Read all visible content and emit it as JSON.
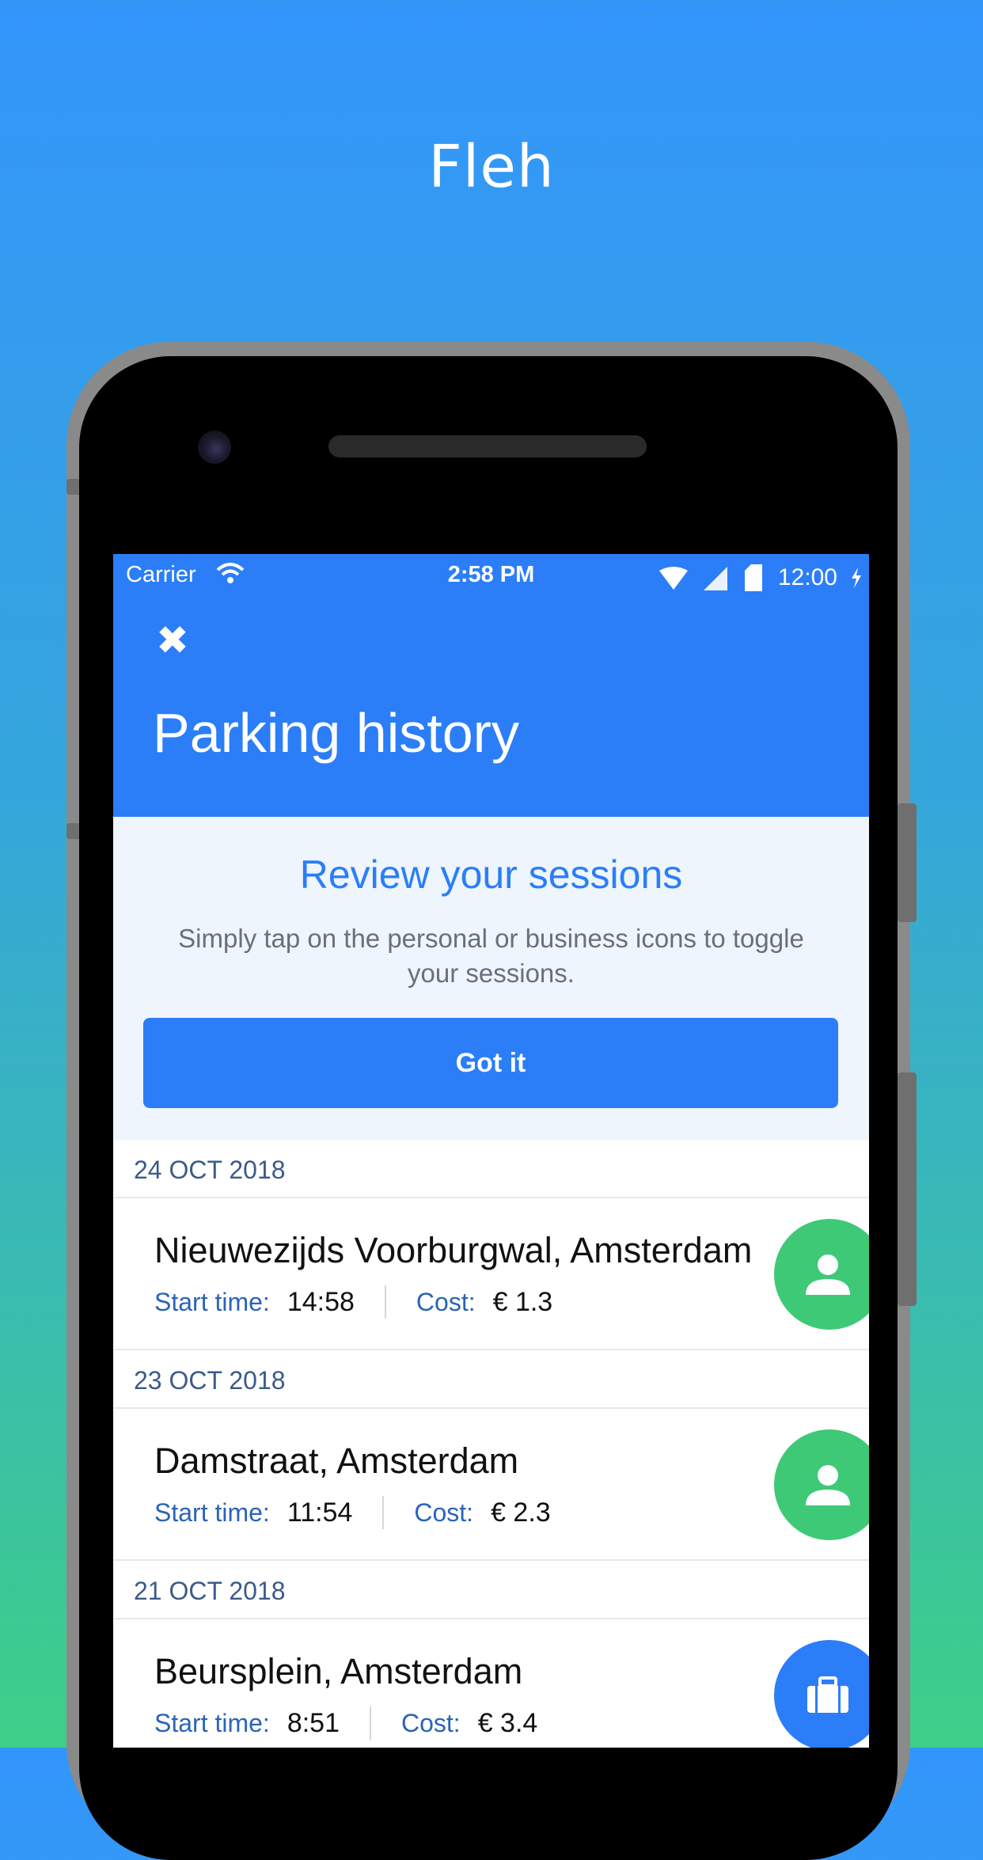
{
  "brand_title": "Fleh",
  "status_bar": {
    "carrier": "Carrier",
    "time": "2:58 PM",
    "clock": "12:00"
  },
  "header": {
    "title": "Parking history"
  },
  "banner": {
    "title": "Review your sessions",
    "text": "Simply tap on the personal or business icons to toggle your sessions.",
    "button_label": "Got it"
  },
  "labels": {
    "start_time": "Start time:",
    "cost": "Cost:"
  },
  "sessions": [
    {
      "date": "24 OCT 2018",
      "location": "Nieuwezijds Voorburgwal, Amsterdam",
      "start_time": "14:58",
      "cost": "€ 1.3",
      "type": "personal",
      "icon": "person-icon"
    },
    {
      "date": "23 OCT 2018",
      "location": "Damstraat, Amsterdam",
      "start_time": "11:54",
      "cost": "€ 2.3",
      "type": "personal",
      "icon": "person-icon"
    },
    {
      "date": "21 OCT 2018",
      "location": "Beursplein, Amsterdam",
      "start_time": "8:51",
      "cost": "€ 3.4",
      "type": "business",
      "icon": "briefcase-icon"
    }
  ],
  "colors": {
    "accent": "#2b7ef8",
    "personal": "#3ec977",
    "banner_bg": "#eef5fd"
  }
}
